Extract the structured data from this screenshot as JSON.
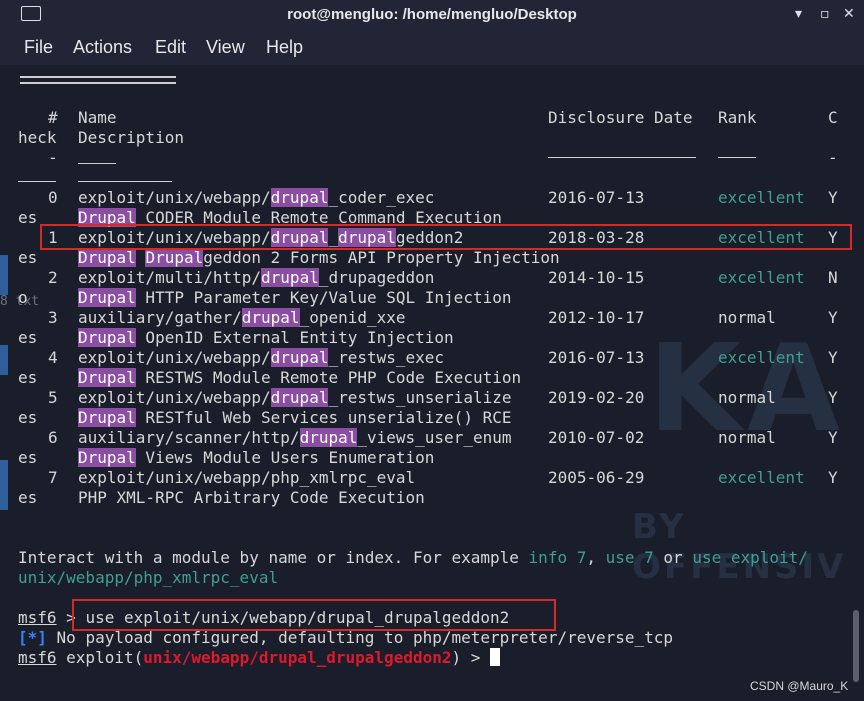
{
  "window": {
    "title": "root@mengluo: /home/mengluo/Desktop",
    "minimize_glyph": "▾",
    "maximize_glyph": "▫",
    "close_glyph": "✕"
  },
  "menu": [
    "File",
    "Actions",
    "Edit",
    "View",
    "Help"
  ],
  "header": {
    "num": "#",
    "name": "Name",
    "date": "Disclosure Date",
    "rank": "Rank",
    "check_c": "C",
    "check_rest": "heck",
    "description": "Description",
    "dash_c": "-",
    "dash_check": "----"
  },
  "modules": [
    {
      "index": "0",
      "path_pre": "exploit/unix/webapp/",
      "hl1": "drupal",
      "path_mid": "_coder_exec",
      "hl2": "",
      "path_post": "",
      "date": "2016-07-13",
      "rank": "excellent",
      "check_c": "Y",
      "check_rest": "es",
      "desc_hl1": "Drupal",
      "desc_mid": "",
      "desc_hl2": "",
      "desc_post": " CODER Module Remote Command Execution"
    },
    {
      "index": "1",
      "path_pre": "exploit/unix/webapp/",
      "hl1": "drupal",
      "path_mid": "_",
      "hl2": "drupal",
      "path_post": "geddon2",
      "date": "2018-03-28",
      "rank": "excellent",
      "check_c": "Y",
      "check_rest": "es",
      "desc_hl1": "Drupal",
      "desc_mid": " ",
      "desc_hl2": "Drupal",
      "desc_post": "geddon 2 Forms API Property Injection"
    },
    {
      "index": "2",
      "path_pre": "exploit/multi/http/",
      "hl1": "drupal",
      "path_mid": "_drupageddon",
      "hl2": "",
      "path_post": "",
      "date": "2014-10-15",
      "rank": "excellent",
      "check_c": "N",
      "check_rest": "o",
      "desc_hl1": "Drupal",
      "desc_mid": "",
      "desc_hl2": "",
      "desc_post": " HTTP Parameter Key/Value SQL Injection"
    },
    {
      "index": "3",
      "path_pre": "auxiliary/gather/",
      "hl1": "drupal",
      "path_mid": "_openid_xxe",
      "hl2": "",
      "path_post": "",
      "date": "2012-10-17",
      "rank": "normal",
      "check_c": "Y",
      "check_rest": "es",
      "desc_hl1": "Drupal",
      "desc_mid": "",
      "desc_hl2": "",
      "desc_post": " OpenID External Entity Injection"
    },
    {
      "index": "4",
      "path_pre": "exploit/unix/webapp/",
      "hl1": "drupal",
      "path_mid": "_restws_exec",
      "hl2": "",
      "path_post": "",
      "date": "2016-07-13",
      "rank": "excellent",
      "check_c": "Y",
      "check_rest": "es",
      "desc_hl1": "Drupal",
      "desc_mid": "",
      "desc_hl2": "",
      "desc_post": " RESTWS Module Remote PHP Code Execution"
    },
    {
      "index": "5",
      "path_pre": "exploit/unix/webapp/",
      "hl1": "drupal",
      "path_mid": "_restws_unserialize",
      "hl2": "",
      "path_post": "",
      "date": "2019-02-20",
      "rank": "normal",
      "check_c": "Y",
      "check_rest": "es",
      "desc_hl1": "Drupal",
      "desc_mid": "",
      "desc_hl2": "",
      "desc_post": " RESTful Web Services unserialize() RCE"
    },
    {
      "index": "6",
      "path_pre": "auxiliary/scanner/http/",
      "hl1": "drupal",
      "path_mid": "_views_user_enum",
      "hl2": "",
      "path_post": "",
      "date": "2010-07-02",
      "rank": "normal",
      "check_c": "Y",
      "check_rest": "es",
      "desc_hl1": "Drupal",
      "desc_mid": "",
      "desc_hl2": "",
      "desc_post": " Views Module Users Enumeration"
    },
    {
      "index": "7",
      "path_pre": "exploit/unix/webapp/php_xmlrpc_eval",
      "hl1": "",
      "path_mid": "",
      "hl2": "",
      "path_post": "",
      "date": "2005-06-29",
      "rank": "excellent",
      "check_c": "Y",
      "check_rest": "es",
      "desc_hl1": "",
      "desc_mid": "",
      "desc_hl2": "",
      "desc_post": "PHP XML-RPC Arbitrary Code Execution"
    }
  ],
  "interact": {
    "text": "Interact with a module by name or index. For example ",
    "info": "info 7",
    "sep1": ", ",
    "use_idx": "use 7",
    "or": " or ",
    "use_path_1": "use exploit/",
    "use_path_2": "unix/webapp/php_xmlrpc_eval"
  },
  "prompt1": {
    "prompt": "msf6",
    "arrow": " > ",
    "command": "use exploit/unix/webapp/drupal_drupalgeddon2"
  },
  "info_line": {
    "tag": "[*]",
    "message": " No payload configured, defaulting to php/meterpreter/reverse_tcp"
  },
  "prompt2": {
    "prompt": "msf6",
    "text_pre": " exploit(",
    "module": "unix/webapp/drupal_drupalgeddon2",
    "text_post": ") > "
  },
  "background": {
    "logo_text": "KA",
    "tagline": "BY OFFENSIV",
    "ghost_text": "8 txt"
  },
  "watermark": "CSDN @Mauro_K",
  "colors": {
    "terminal_bg": "#1a1d2a",
    "highlight": "#8c4ea3",
    "rank_green": "#3f9f95",
    "prompt_red": "#e0182b",
    "info_blue": "#3b82f6",
    "annotation_red": "#d62a2a"
  }
}
